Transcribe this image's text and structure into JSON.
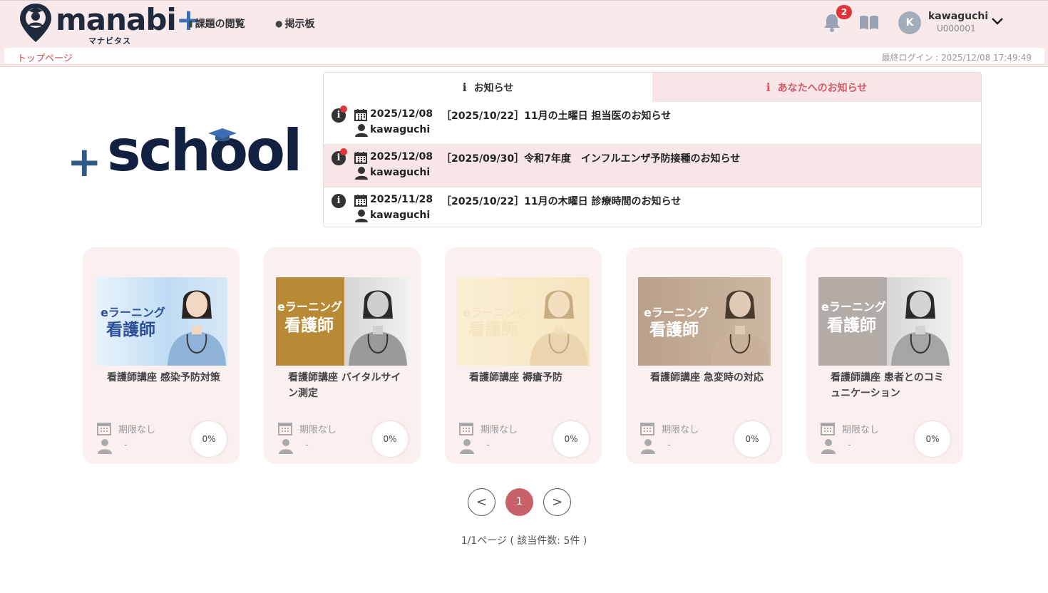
{
  "header": {
    "logo_text": "manabi",
    "logo_plus": "+",
    "logo_sub": "マナビタス",
    "nav": [
      {
        "label": "課題の閲覧",
        "icon": "document-icon"
      },
      {
        "label": "掲示板",
        "icon": "chat-bubble-icon"
      }
    ],
    "notification_count": "2",
    "user": {
      "initial": "K",
      "name": "kawaguchi",
      "id": "U000001"
    }
  },
  "breadcrumb": {
    "label": "トップページ",
    "last_login": "最終ログイン : 2025/12/08 17:49:49"
  },
  "school_logo": {
    "plus": "+",
    "word": "school"
  },
  "notices": {
    "tabs": [
      {
        "icon": "i",
        "label": "お知らせ"
      },
      {
        "icon": "i",
        "label": "あなたへのお知らせ"
      }
    ],
    "items": [
      {
        "date": "2025/12/08",
        "title": "［2025/10/22］11月の土曜日 担当医のお知らせ",
        "user": "kawaguchi",
        "unread": true
      },
      {
        "date": "2025/12/08",
        "title": "［2025/09/30］令和7年度　インフルエンザ予防接種のお知らせ",
        "user": "kawaguchi",
        "unread": true
      },
      {
        "date": "2025/11/28",
        "title": "［2025/10/22］11月の木曜日 診療時間のお知らせ",
        "user": "kawaguchi",
        "unread": false
      }
    ]
  },
  "courses": [
    {
      "title": "看護師講座 感染予防対策",
      "due": "期限なし",
      "user": "-",
      "progress": "0%",
      "thumb_el": "eラーニング",
      "thumb_big": "看護師"
    },
    {
      "title": "看護師講座 バイタルサイン測定",
      "due": "期限なし",
      "user": "-",
      "progress": "0%",
      "thumb_el": "eラーニング",
      "thumb_big": "看護師"
    },
    {
      "title": "看護師講座 褥瘡予防",
      "due": "期限なし",
      "user": "-",
      "progress": "0%",
      "thumb_el": "eラーニング",
      "thumb_big": "看護師"
    },
    {
      "title": "看護師講座 急変時の対応",
      "due": "期限なし",
      "user": "-",
      "progress": "0%",
      "thumb_el": "eラーニング",
      "thumb_big": "看護師"
    },
    {
      "title": "看護師講座 患者とのコミュニケーション",
      "due": "期限なし",
      "user": "-",
      "progress": "0%",
      "thumb_el": "eラーニング",
      "thumb_big": "看護師"
    }
  ],
  "pagination": {
    "prev": "<",
    "current": "1",
    "next": ">",
    "info": "1/1ページ ( 該当件数: 5件 )"
  },
  "colors": {
    "accent": "#c9616b",
    "header_bg": "#f8e9ea",
    "card_bg": "#fbf0f0",
    "badge": "#e0333a"
  }
}
